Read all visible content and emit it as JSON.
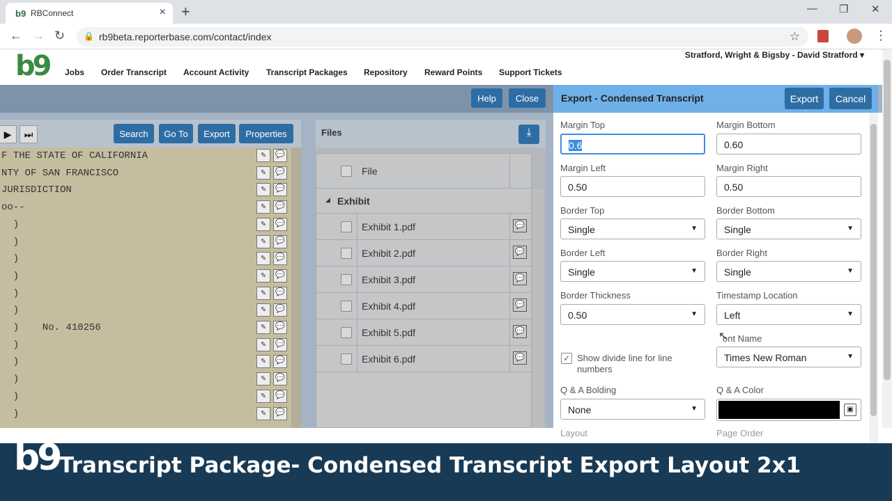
{
  "browser": {
    "tab_title": "RBConnect",
    "favicon": "b9",
    "url": "rb9beta.reporterbase.com/contact/index"
  },
  "app": {
    "logo": "b9",
    "menu": [
      "Jobs",
      "Order Transcript",
      "Account Activity",
      "Transcript Packages",
      "Repository",
      "Reward Points",
      "Support Tickets"
    ],
    "user": "Stratford, Wright & Bigsby - David Stratford ▾"
  },
  "toolbar": {
    "help": "Help",
    "close": "Close"
  },
  "viewer": {
    "buttons": [
      "Search",
      "Go To",
      "Export",
      "Properties"
    ],
    "lines": [
      "F THE STATE OF CALIFORNIA",
      "NTY OF SAN FRANCISCO",
      "JURISDICTION",
      "oo--",
      "  )",
      "  )",
      "  )",
      "  )",
      "  )",
      "  )",
      "  )    No. 410256",
      "  )",
      "  )",
      "  )",
      "  )",
      "  )"
    ]
  },
  "files": {
    "title": "Files",
    "column": "File",
    "group": "Exhibit",
    "items": [
      "Exhibit 1.pdf",
      "Exhibit 2.pdf",
      "Exhibit 3.pdf",
      "Exhibit 4.pdf",
      "Exhibit 5.pdf",
      "Exhibit 6.pdf"
    ]
  },
  "export_panel": {
    "title": "Export - Condensed Transcript",
    "export_btn": "Export",
    "cancel_btn": "Cancel",
    "margin_top_label": "Margin Top",
    "margin_top": "0.6",
    "margin_bottom_label": "Margin Bottom",
    "margin_bottom": "0.60",
    "margin_left_label": "Margin Left",
    "margin_left": "0.50",
    "margin_right_label": "Margin Right",
    "margin_right": "0.50",
    "border_top_label": "Border Top",
    "border_top": "Single",
    "border_bottom_label": "Border Bottom",
    "border_bottom": "Single",
    "border_left_label": "Border Left",
    "border_left": "Single",
    "border_right_label": "Border Right",
    "border_right": "Single",
    "border_thickness_label": "Border Thickness",
    "border_thickness": "0.50",
    "timestamp_label": "Timestamp Location",
    "timestamp": "Left",
    "divide_line_label": "Show divide line for line numbers",
    "divide_line_checked": true,
    "font_name_label": "ont Name",
    "font_name": "Times New Roman",
    "qa_bolding_label": "Q & A Bolding",
    "qa_bolding": "None",
    "qa_color_label": "Q & A Color",
    "qa_color": "#000000",
    "layout_label": "Layout",
    "page_order_label": "Page Order"
  },
  "banner": {
    "logo": "b9",
    "title": "Transcript Package- Condensed Transcript Export Layout 2x1"
  }
}
